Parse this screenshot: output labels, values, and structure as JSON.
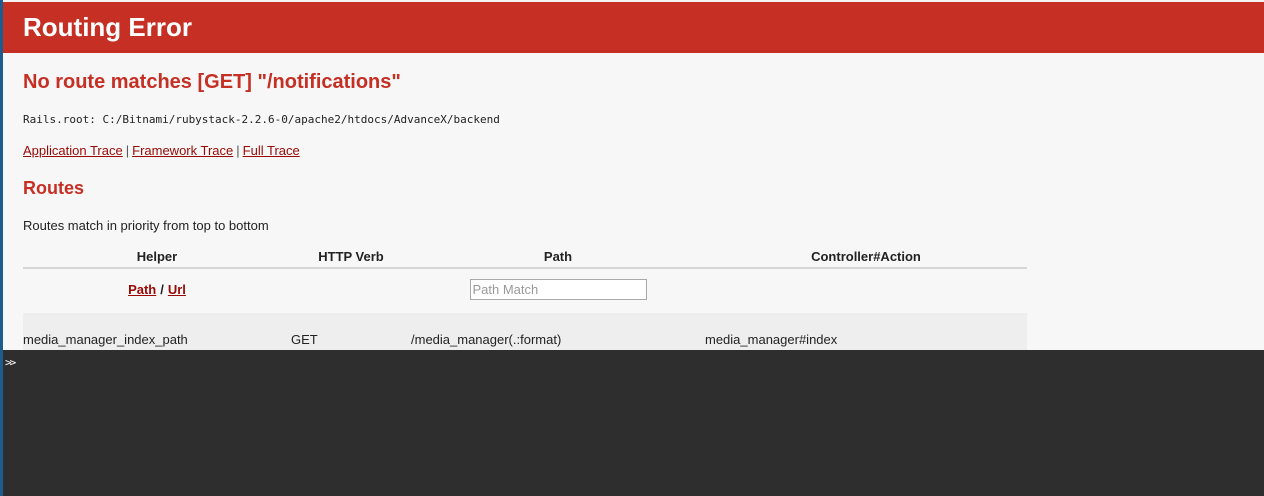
{
  "header": {
    "title": "Routing Error"
  },
  "error": {
    "message": "No route matches [GET] \"/notifications\""
  },
  "rails_root": "Rails.root: C:/Bitnami/rubystack-2.2.6-0/apache2/htdocs/AdvanceX/backend",
  "traces": {
    "application": "Application Trace",
    "framework": "Framework Trace",
    "full": "Full Trace",
    "separator": "|"
  },
  "routes": {
    "heading": "Routes",
    "description": "Routes match in priority from top to bottom",
    "columns": [
      "Helper",
      "HTTP Verb",
      "Path",
      "Controller#Action"
    ],
    "filter": {
      "path_link": "Path",
      "slash": "/",
      "url_link": "Url",
      "search_placeholder": "Path Match"
    },
    "rows": [
      {
        "helper": "media_manager_index_path",
        "verb": "GET",
        "path": "/media_manager(.:format)",
        "action": "media_manager#index"
      }
    ]
  },
  "console": {
    "prompt": ">>"
  },
  "colors": {
    "header_bg": "#c52f24",
    "heading_red": "#c52f24",
    "link_red": "#980905",
    "page_bg": "#f7f7f7",
    "console_bg": "#2e2e2e"
  }
}
